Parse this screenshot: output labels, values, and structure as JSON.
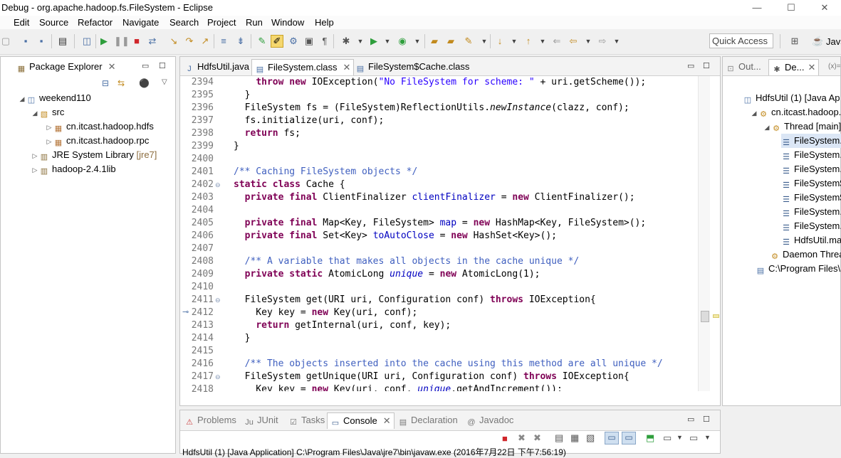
{
  "window": {
    "title": "Debug - org.apache.hadoop.fs.FileSystem - Eclipse",
    "controls": [
      "—",
      "☐",
      "✕"
    ]
  },
  "menu": [
    "Edit",
    "Source",
    "Refactor",
    "Navigate",
    "Search",
    "Project",
    "Run",
    "Window",
    "Help"
  ],
  "toolbar": {
    "quick_access": "Quick Access",
    "perspective_label": "Java"
  },
  "package_explorer": {
    "title": "Package Explorer",
    "tree": [
      {
        "label": "weekend110",
        "tag": ""
      },
      {
        "label": "src",
        "tag": ""
      },
      {
        "label": "cn.itcast.hadoop.hdfs",
        "tag": ""
      },
      {
        "label": "cn.itcast.hadoop.rpc",
        "tag": ""
      },
      {
        "label": "JRE System Library",
        "tag": "[jre7]"
      },
      {
        "label": "hadoop-2.4.1lib",
        "tag": ""
      }
    ]
  },
  "editor": {
    "tabs": [
      "HdfsUtil.java",
      "FileSystem.class",
      "FileSystem$Cache.class"
    ],
    "active_tab": 1,
    "line_numbers": [
      "2394",
      "2395",
      "2396",
      "2397",
      "2398",
      "2399",
      "2400",
      "2401",
      "2402",
      "2403",
      "2404",
      "2405",
      "2406",
      "2407",
      "2408",
      "2409",
      "2410",
      "2411",
      "2412",
      "2413",
      "2414",
      "2415",
      "2416",
      "2417",
      "2418"
    ]
  },
  "outline_panel": {
    "tabs": [
      "Out...",
      "De..."
    ],
    "extra": "(x)="
  },
  "debug_tree": [
    "HdfsUtil (1) [Java Ap",
    "cn.itcast.hadoop.h",
    "Thread [main] (",
    "FileSystem.",
    "FileSystem.",
    "FileSystem.",
    "FileSystem$",
    "FileSystem$",
    "FileSystem.",
    "FileSystem.",
    "HdfsUtil.ma",
    "Daemon Threa",
    "C:\\Program Files\\"
  ],
  "bottom": {
    "tabs": [
      "Problems",
      "JUnit",
      "Tasks",
      "Console",
      "Declaration",
      "Javadoc"
    ],
    "console_output": "HdfsUtil (1) [Java Application] C:\\Program Files\\Java\\jre7\\bin\\javaw.exe (2016年7月22日 下午7:56:19)"
  },
  "colors": {
    "keyword": "#7f0055",
    "string": "#2a00ff",
    "comment": "#3f5fbf",
    "field": "#0000c0",
    "line_number": "#787878",
    "selection": "#dbe6f5"
  }
}
